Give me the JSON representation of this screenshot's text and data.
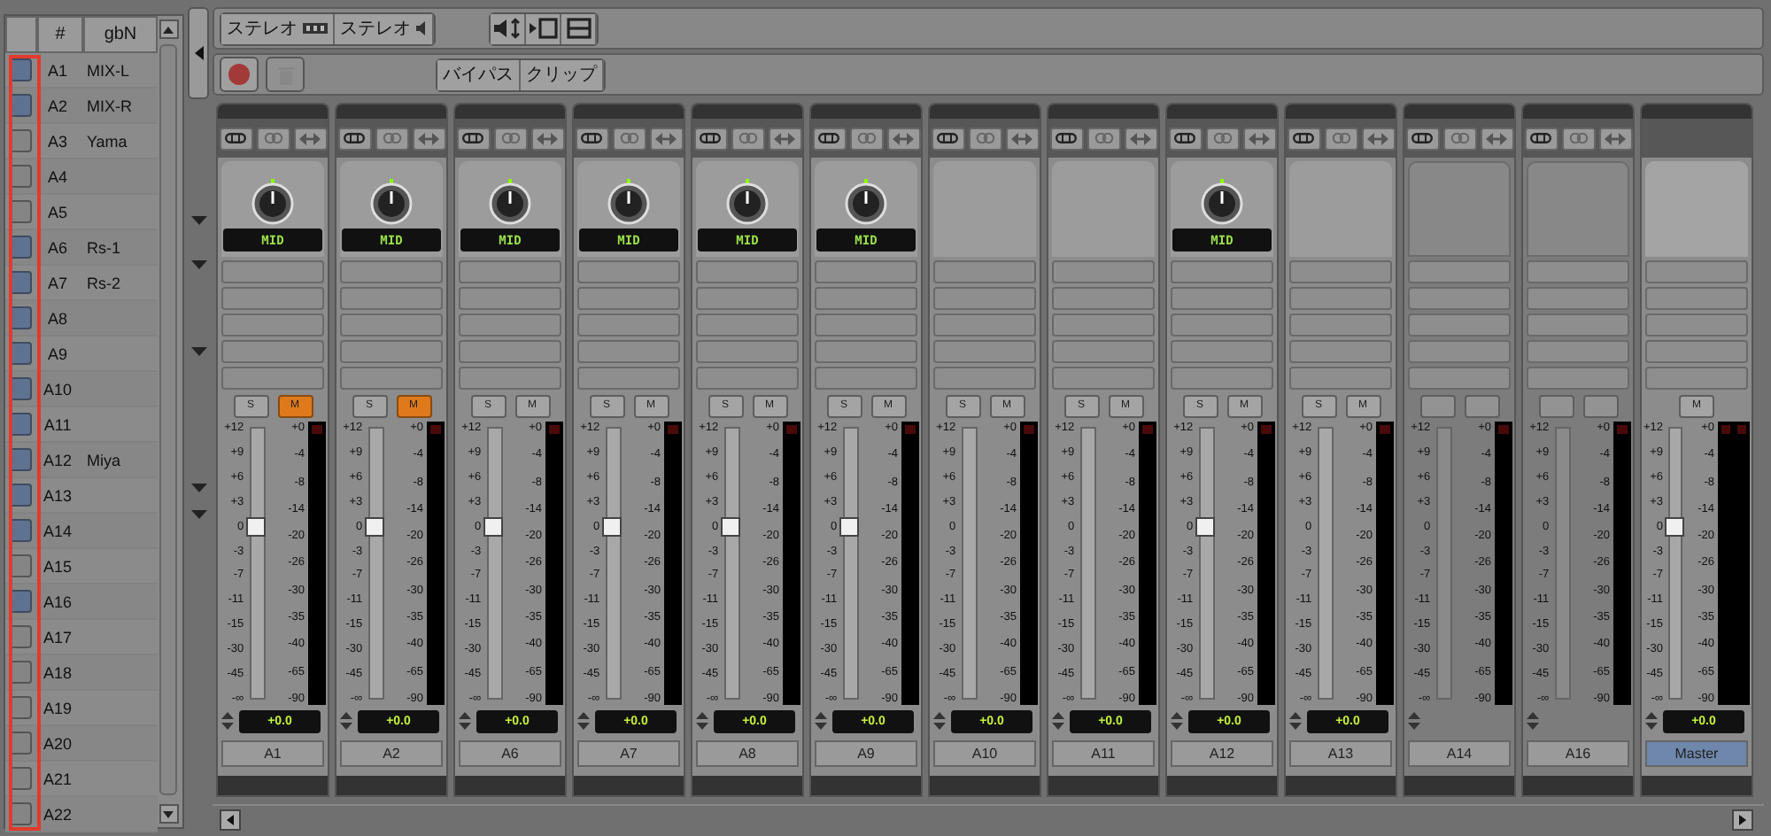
{
  "track_list": {
    "columns": [
      "#",
      "gbN"
    ],
    "rows": [
      {
        "checked": true,
        "number": "A1",
        "name": "MIX-L"
      },
      {
        "checked": true,
        "number": "A2",
        "name": "MIX-R"
      },
      {
        "checked": false,
        "number": "A3",
        "name": "Yama"
      },
      {
        "checked": false,
        "number": "A4"
      },
      {
        "checked": false,
        "number": "A5"
      },
      {
        "checked": true,
        "number": "A6",
        "name": "Rs-1"
      },
      {
        "checked": true,
        "number": "A7",
        "name": "Rs-2"
      },
      {
        "checked": true,
        "number": "A8"
      },
      {
        "checked": true,
        "number": "A9"
      },
      {
        "checked": true,
        "number": "A10"
      },
      {
        "checked": true,
        "number": "A11"
      },
      {
        "checked": true,
        "number": "A12",
        "name": "Miya"
      },
      {
        "checked": true,
        "number": "A13"
      },
      {
        "checked": true,
        "number": "A14"
      },
      {
        "checked": false,
        "number": "A15"
      },
      {
        "checked": true,
        "number": "A16"
      },
      {
        "checked": false,
        "number": "A17"
      },
      {
        "checked": false,
        "number": "A18"
      },
      {
        "checked": false,
        "number": "A19"
      },
      {
        "checked": false,
        "number": "A20"
      },
      {
        "checked": false,
        "number": "A21"
      },
      {
        "checked": false,
        "number": "A22"
      }
    ]
  },
  "toolbar": {
    "output_buttons": [
      "ステレオ",
      "ステレオ"
    ],
    "bypass_buttons": [
      "バイパス",
      "クリップ"
    ]
  },
  "strips": [
    {
      "name": "A1",
      "kind": "full",
      "selected": false,
      "pan": "MID",
      "solo": {
        "label": "S",
        "on": false
      },
      "mute": {
        "label": "M",
        "on": true
      },
      "level": 0.64,
      "value": "+0.0",
      "fader_scale": [
        "+12",
        "+9",
        "+6",
        "+3",
        "0",
        "-3",
        "-7",
        "-11",
        "-15",
        "-30",
        "-45",
        "-∞"
      ],
      "meter_scale": [
        "+0",
        "-4",
        "-8",
        "-14",
        "-20",
        "-26",
        "-30",
        "-35",
        "-40",
        "-65",
        "-90"
      ]
    },
    {
      "name": "A2",
      "kind": "full",
      "selected": false,
      "pan": "MID",
      "solo": {
        "label": "S",
        "on": false
      },
      "mute": {
        "label": "M",
        "on": true
      },
      "level": 0.64,
      "value": "+0.0",
      "fader_scale": [
        "+12",
        "+9",
        "+6",
        "+3",
        "0",
        "-3",
        "-7",
        "-11",
        "-15",
        "-30",
        "-45",
        "-∞"
      ],
      "meter_scale": [
        "+0",
        "-4",
        "-8",
        "-14",
        "-20",
        "-26",
        "-30",
        "-35",
        "-40",
        "-65",
        "-90"
      ]
    },
    {
      "name": "A6",
      "kind": "full",
      "selected": false,
      "pan": "MID",
      "solo": {
        "label": "S",
        "on": false
      },
      "mute": {
        "label": "M",
        "on": false
      },
      "level": 0.64,
      "value": "+0.0",
      "fader_scale": [
        "+12",
        "+9",
        "+6",
        "+3",
        "0",
        "-3",
        "-7",
        "-11",
        "-15",
        "-30",
        "-45",
        "-∞"
      ],
      "meter_scale": [
        "+0",
        "-4",
        "-8",
        "-14",
        "-20",
        "-26",
        "-30",
        "-35",
        "-40",
        "-65",
        "-90"
      ]
    },
    {
      "name": "A7",
      "kind": "full",
      "selected": false,
      "pan": "MID",
      "solo": {
        "label": "S",
        "on": false
      },
      "mute": {
        "label": "M",
        "on": false
      },
      "level": 0.64,
      "value": "+0.0",
      "fader_scale": [
        "+12",
        "+9",
        "+6",
        "+3",
        "0",
        "-3",
        "-7",
        "-11",
        "-15",
        "-30",
        "-45",
        "-∞"
      ],
      "meter_scale": [
        "+0",
        "-4",
        "-8",
        "-14",
        "-20",
        "-26",
        "-30",
        "-35",
        "-40",
        "-65",
        "-90"
      ]
    },
    {
      "name": "A8",
      "kind": "full",
      "selected": false,
      "pan": "MID",
      "solo": {
        "label": "S",
        "on": false
      },
      "mute": {
        "label": "M",
        "on": false
      },
      "level": 0.64,
      "value": "+0.0",
      "fader_scale": [
        "+12",
        "+9",
        "+6",
        "+3",
        "0",
        "-3",
        "-7",
        "-11",
        "-15",
        "-30",
        "-45",
        "-∞"
      ],
      "meter_scale": [
        "+0",
        "-4",
        "-8",
        "-14",
        "-20",
        "-26",
        "-30",
        "-35",
        "-40",
        "-65",
        "-90"
      ]
    },
    {
      "name": "A9",
      "kind": "full",
      "selected": false,
      "pan": "MID",
      "solo": {
        "label": "S",
        "on": false
      },
      "mute": {
        "label": "M",
        "on": false
      },
      "level": 0.64,
      "value": "+0.0",
      "fader_scale": [
        "+12",
        "+9",
        "+6",
        "+3",
        "0",
        "-3",
        "-7",
        "-11",
        "-15",
        "-30",
        "-45",
        "-∞"
      ],
      "meter_scale": [
        "+0",
        "-4",
        "-8",
        "-14",
        "-20",
        "-26",
        "-30",
        "-35",
        "-40",
        "-65",
        "-90"
      ]
    },
    {
      "name": "A10",
      "kind": "blank",
      "selected": false,
      "solo": {
        "label": "S",
        "on": false
      },
      "mute": {
        "label": "M",
        "on": false
      },
      "value": "+0.0",
      "fader_scale": [
        "+12",
        "+9",
        "+6",
        "+3",
        "0",
        "-3",
        "-7",
        "-11",
        "-15",
        "-30",
        "-45",
        "-∞"
      ],
      "meter_scale": [
        "+0",
        "-4",
        "-8",
        "-14",
        "-20",
        "-26",
        "-30",
        "-35",
        "-40",
        "-65",
        "-90"
      ]
    },
    {
      "name": "A11",
      "kind": "blank",
      "selected": false,
      "solo": {
        "label": "S",
        "on": false
      },
      "mute": {
        "label": "M",
        "on": false
      },
      "value": "+0.0",
      "fader_scale": [
        "+12",
        "+9",
        "+6",
        "+3",
        "0",
        "-3",
        "-7",
        "-11",
        "-15",
        "-30",
        "-45",
        "-∞"
      ],
      "meter_scale": [
        "+0",
        "-4",
        "-8",
        "-14",
        "-20",
        "-26",
        "-30",
        "-35",
        "-40",
        "-65",
        "-90"
      ]
    },
    {
      "name": "A12",
      "kind": "full",
      "selected": false,
      "pan": "MID",
      "solo": {
        "label": "S",
        "on": false
      },
      "mute": {
        "label": "M",
        "on": false
      },
      "level": 0.64,
      "value": "+0.0",
      "fader_scale": [
        "+12",
        "+9",
        "+6",
        "+3",
        "0",
        "-3",
        "-7",
        "-11",
        "-15",
        "-30",
        "-45",
        "-∞"
      ],
      "meter_scale": [
        "+0",
        "-4",
        "-8",
        "-14",
        "-20",
        "-26",
        "-30",
        "-35",
        "-40",
        "-65",
        "-90"
      ]
    },
    {
      "name": "A13",
      "kind": "blank",
      "selected": false,
      "solo": {
        "label": "S",
        "on": false
      },
      "mute": {
        "label": "M",
        "on": false
      },
      "value": "+0.0",
      "fader_scale": [
        "+12",
        "+9",
        "+6",
        "+3",
        "0",
        "-3",
        "-7",
        "-11",
        "-15",
        "-30",
        "-45",
        "-∞"
      ],
      "meter_scale": [
        "+0",
        "-4",
        "-8",
        "-14",
        "-20",
        "-26",
        "-30",
        "-35",
        "-40",
        "-65",
        "-90"
      ]
    },
    {
      "name": "A14",
      "kind": "inactive",
      "selected": false,
      "fader_scale": [
        "+12",
        "+9",
        "+6",
        "+3",
        "0",
        "-3",
        "-7",
        "-11",
        "-15",
        "-30",
        "-45",
        "-∞"
      ],
      "meter_scale": [
        "+0",
        "-4",
        "-8",
        "-14",
        "-20",
        "-26",
        "-30",
        "-35",
        "-40",
        "-65",
        "-90"
      ]
    },
    {
      "name": "A16",
      "kind": "inactive",
      "selected": false,
      "fader_scale": [
        "+12",
        "+9",
        "+6",
        "+3",
        "0",
        "-3",
        "-7",
        "-11",
        "-15",
        "-30",
        "-45",
        "-∞"
      ],
      "meter_scale": [
        "+0",
        "-4",
        "-8",
        "-14",
        "-20",
        "-26",
        "-30",
        "-35",
        "-40",
        "-65",
        "-90"
      ]
    },
    {
      "name": "Master",
      "kind": "master",
      "selected": true,
      "mute": {
        "label": "M",
        "on": false
      },
      "level": 0.64,
      "value": "+0.0",
      "fader_scale": [
        "+12",
        "+9",
        "+6",
        "+3",
        "0",
        "-3",
        "-7",
        "-11",
        "-15",
        "-30",
        "-45",
        "-∞"
      ],
      "meter_scale": [
        "+0",
        "-4",
        "-8",
        "-14",
        "-20",
        "-26",
        "-30",
        "-35",
        "-40",
        "-65",
        "-90"
      ]
    }
  ]
}
